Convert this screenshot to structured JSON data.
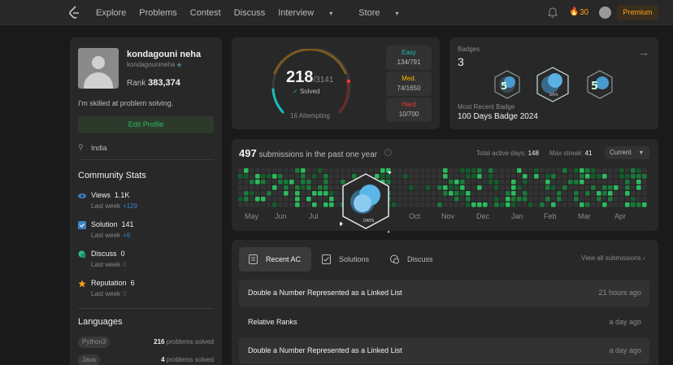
{
  "nav": {
    "links": [
      "Explore",
      "Problems",
      "Contest",
      "Discuss",
      "Interview",
      "Store"
    ],
    "streak": "30",
    "premium": "Premium"
  },
  "profile": {
    "name": "kondagouni neha",
    "handle": "kondagounineha",
    "rank_label": "Rank",
    "rank_value": "383,374",
    "bio": "I'm skilled at problem solving.",
    "edit_label": "Edit Profile",
    "location": "India"
  },
  "community": {
    "title": "Community Stats",
    "items": [
      {
        "label": "Views",
        "value": "1.1K",
        "last_week": "Last week",
        "delta": "+129",
        "icon": "eye-icon"
      },
      {
        "label": "Solution",
        "value": "141",
        "last_week": "Last week",
        "delta": "+6",
        "icon": "solution-icon"
      },
      {
        "label": "Discuss",
        "value": "0",
        "last_week": "Last week",
        "delta": "0",
        "icon": "discuss-icon"
      },
      {
        "label": "Reputation",
        "value": "6",
        "last_week": "Last week",
        "delta": "0",
        "icon": "star-icon"
      }
    ]
  },
  "languages": {
    "title": "Languages",
    "items": [
      {
        "name": "Python3",
        "count": "216",
        "suffix": "problems solved"
      },
      {
        "name": "Java",
        "count": "4",
        "suffix": "problems solved"
      }
    ]
  },
  "solved": {
    "count": "218",
    "total": "/3141",
    "label": "Solved",
    "attempting": "16 Attempting",
    "fraction": 0.069,
    "difficulty": [
      {
        "name": "Easy",
        "value": "134/791",
        "color": "#1cbaba"
      },
      {
        "name": "Med.",
        "value": "74/1650",
        "color": "#ffb700"
      },
      {
        "name": "Hard",
        "value": "10/700",
        "color": "#f63737"
      }
    ]
  },
  "badges": {
    "label": "Badges",
    "count": "3",
    "recent_label": "Most Recent Badge",
    "recent_name": "100 Days Badge 2024"
  },
  "submissions": {
    "count": "497",
    "text": "submissions in the past one year",
    "active_label": "Total active days:",
    "active_value": "148",
    "streak_label": "Max streak:",
    "streak_value": "41",
    "period": "Current",
    "months": [
      "May",
      "Jun",
      "Jul",
      "Oct",
      "Nov",
      "Dec",
      "Jan",
      "Feb",
      "Mar",
      "Apr"
    ],
    "overlay_text": "DAYS"
  },
  "recent": {
    "tabs": [
      "Recent AC",
      "Solutions",
      "Discuss"
    ],
    "view_all": "View all submissions",
    "rows": [
      {
        "title": "Double a Number Represented as a Linked List",
        "time": "21 hours ago"
      },
      {
        "title": "Relative Ranks",
        "time": "a day ago"
      },
      {
        "title": "Double a Number Represented as a Linked List",
        "time": "a day ago"
      }
    ]
  },
  "colors": {
    "accent": "#ffa116",
    "green": "#2cbb5d",
    "easy": "#1cbaba",
    "medium": "#ffb700",
    "hard": "#f63737"
  }
}
